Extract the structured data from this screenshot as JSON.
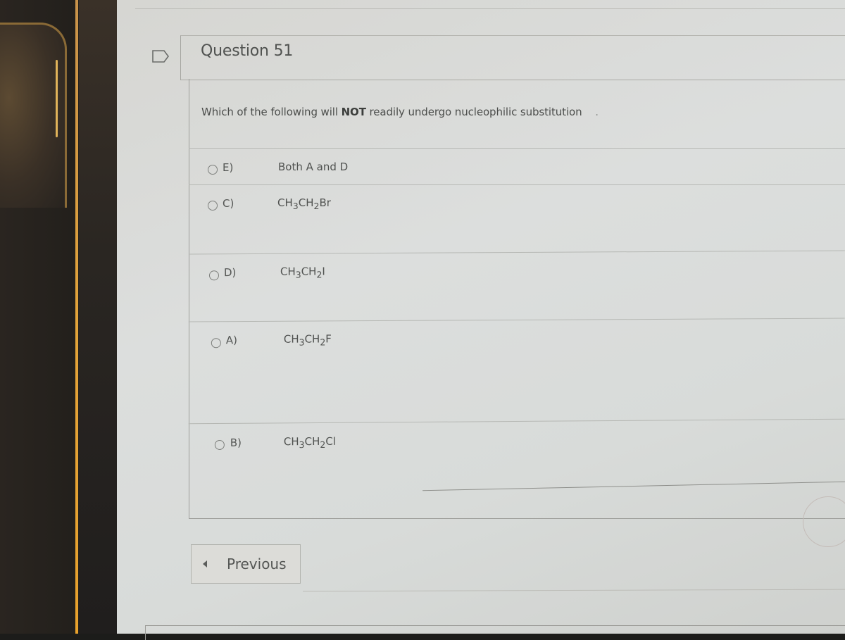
{
  "question": {
    "title": "Question 51",
    "text_before": "Which of the following will ",
    "text_emphasis": "NOT",
    "text_after": " readily undergo nucleophilic substitution",
    "trailing_mark": "."
  },
  "answers": [
    {
      "letter": "E)",
      "text": "Both A and D",
      "selected": false
    },
    {
      "letter": "C)",
      "text": "CH3CH2Br",
      "selected": false
    },
    {
      "letter": "D)",
      "text": "CH3CH2I",
      "selected": false
    },
    {
      "letter": "A)",
      "text": "CH3CH2F",
      "selected": false
    },
    {
      "letter": "B)",
      "text": "CH3CH2Cl",
      "selected": false
    }
  ],
  "navigation": {
    "previous_label": "Previous",
    "previous_icon": "triangle-left-icon"
  },
  "icons": {
    "flag": "flag-icon"
  },
  "colors": {
    "screen_bg": "#d9dbd9",
    "text": "#505250",
    "border": "#a5a5a0",
    "bezel_accent": "#e2a33a"
  }
}
